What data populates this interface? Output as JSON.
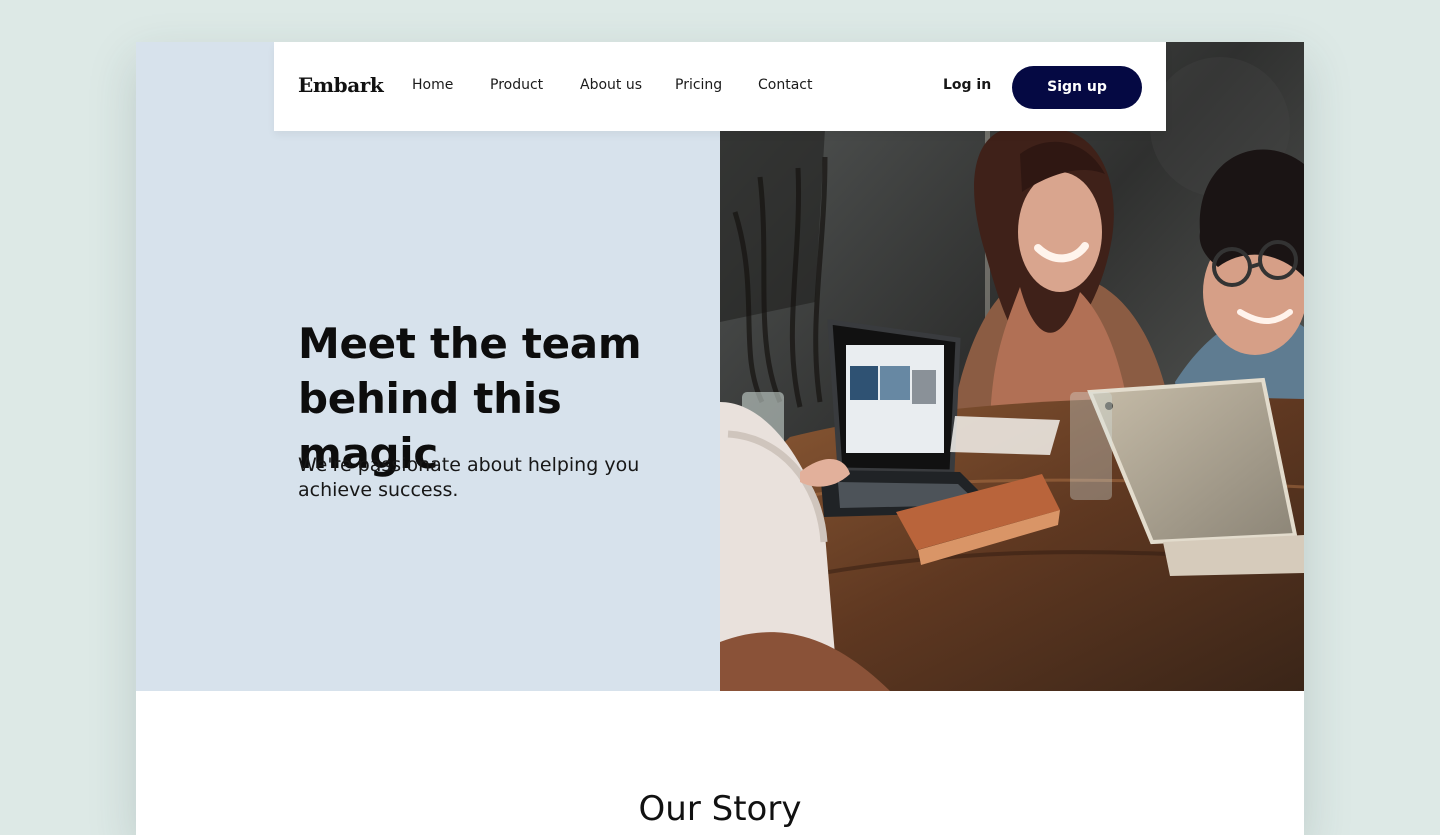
{
  "brand": "Embark",
  "nav": {
    "links": [
      "Home",
      "Product",
      "About us",
      "Pricing",
      "Contact"
    ],
    "login_label": "Log in",
    "signup_label": "Sign up"
  },
  "hero": {
    "headline_line_1": "Meet the team",
    "headline_line_2": "behind this magic",
    "description": "We're passionate about helping you achieve success."
  },
  "story": {
    "title": "Our Story"
  },
  "colors": {
    "background": "#dde9e6",
    "hero_panel": "#d7e2ec",
    "primary_button": "#050943",
    "text": "#111111"
  }
}
